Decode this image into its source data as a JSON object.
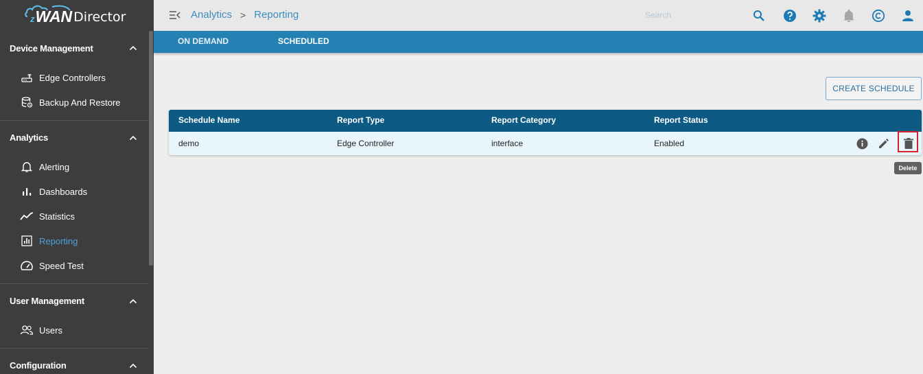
{
  "app": {
    "brand_prefix": "z",
    "brand": "WAN",
    "product": "Director"
  },
  "sidebar": {
    "sections": [
      {
        "title": "Device Management",
        "items": [
          {
            "label": "Edge Controllers",
            "icon": "router-icon"
          },
          {
            "label": "Backup And Restore",
            "icon": "database-backup-icon"
          }
        ]
      },
      {
        "title": "Analytics",
        "items": [
          {
            "label": "Alerting",
            "icon": "bell-icon"
          },
          {
            "label": "Dashboards",
            "icon": "bar-chart-icon"
          },
          {
            "label": "Statistics",
            "icon": "trend-line-icon"
          },
          {
            "label": "Reporting",
            "icon": "report-icon",
            "active": true
          },
          {
            "label": "Speed Test",
            "icon": "speedometer-icon"
          }
        ]
      },
      {
        "title": "User Management",
        "items": [
          {
            "label": "Users",
            "icon": "users-icon"
          }
        ]
      },
      {
        "title": "Configuration",
        "items": []
      }
    ]
  },
  "topbar": {
    "breadcrumb": [
      "Analytics",
      "Reporting"
    ],
    "separator": ">",
    "search_placeholder": "Search",
    "icons": [
      "search-icon",
      "help-icon",
      "settings-icon",
      "notifications-icon",
      "copyright-icon",
      "account-icon"
    ]
  },
  "tabs": [
    {
      "label": "ON DEMAND",
      "active": false
    },
    {
      "label": "SCHEDULED",
      "active": true
    }
  ],
  "actions": {
    "create_schedule": "CREATE SCHEDULE"
  },
  "table": {
    "columns": [
      "Schedule Name",
      "Report Type",
      "Report Category",
      "Report Status"
    ],
    "rows": [
      [
        "demo",
        "Edge Controller",
        "interface",
        "Enabled"
      ]
    ],
    "row_actions": [
      "info-icon",
      "edit-icon",
      "delete-icon"
    ]
  },
  "tooltip": {
    "text": "Delete"
  },
  "colors": {
    "sidebar_bg": "#3d3d3d",
    "accent": "#4aa3d8",
    "tabs_bg": "#2580b3",
    "table_header_bg": "#0d5a85",
    "row_bg": "#e8f6fb",
    "highlight": "#d9212b"
  }
}
